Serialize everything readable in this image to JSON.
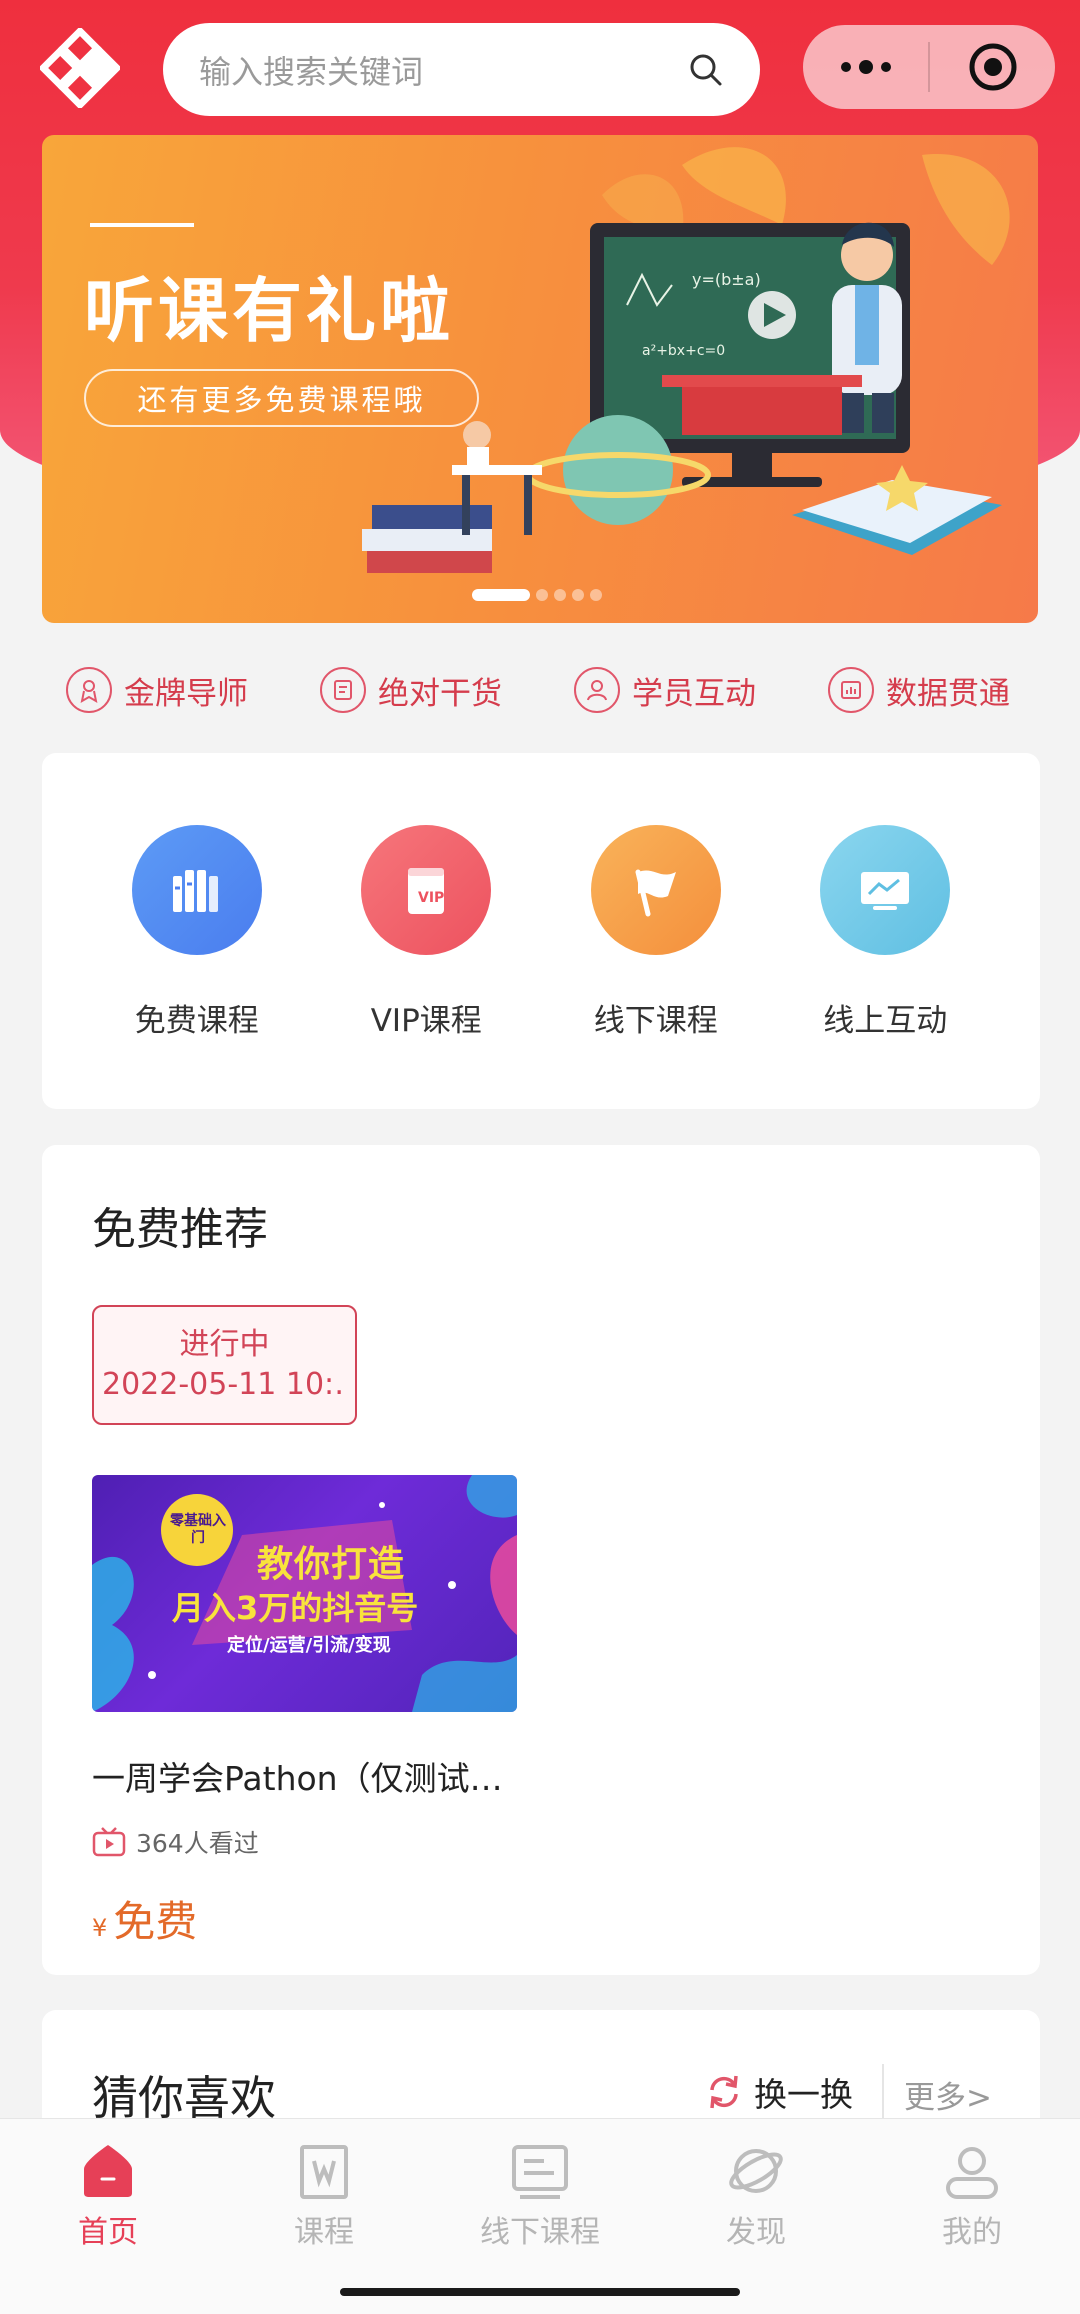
{
  "header": {
    "search_placeholder": "输入搜索关键词"
  },
  "banner": {
    "title": "听课有礼啦",
    "subtitle": "还有更多免费课程哦",
    "slides": 5,
    "active_slide": 1
  },
  "features": [
    {
      "label": "金牌导师",
      "icon": "medal-icon"
    },
    {
      "label": "绝对干货",
      "icon": "document-icon"
    },
    {
      "label": "学员互动",
      "icon": "people-icon"
    },
    {
      "label": "数据贯通",
      "icon": "chart-icon"
    }
  ],
  "categories": [
    {
      "label": "免费课程",
      "icon": "books-icon",
      "color": "#5b8ef2"
    },
    {
      "label": "VIP课程",
      "icon": "vip-book-icon",
      "color": "#f0636d"
    },
    {
      "label": "线下课程",
      "icon": "flag-icon",
      "color": "#f7a04c"
    },
    {
      "label": "线上互动",
      "icon": "monitor-chart-icon",
      "color": "#74cbe8"
    }
  ],
  "free_section": {
    "title": "免费推荐",
    "status": "进行中",
    "time": "2022-05-11 10:…",
    "course": {
      "title": "一周学会Pathon（仅测试…",
      "views": "364人看过",
      "currency": "¥",
      "price": "免费",
      "image_badge": "零基础入门",
      "image_line1": "教你打造",
      "image_line2": "月入3万的抖音号",
      "image_line3": "定位/运营/引流/变现"
    }
  },
  "guess_section": {
    "title": "猜你喜欢",
    "refresh": "换一换",
    "more": "更多>"
  },
  "tabbar": [
    {
      "label": "首页",
      "icon": "home-icon",
      "active": true
    },
    {
      "label": "课程",
      "icon": "course-book-icon",
      "active": false
    },
    {
      "label": "线下课程",
      "icon": "offline-course-icon",
      "active": false
    },
    {
      "label": "发现",
      "icon": "planet-icon",
      "active": false
    },
    {
      "label": "我的",
      "icon": "profile-icon",
      "active": false
    }
  ],
  "colors": {
    "brand_red": "#ef2f3e",
    "active_tab": "#e64057",
    "price": "#e36a29"
  }
}
